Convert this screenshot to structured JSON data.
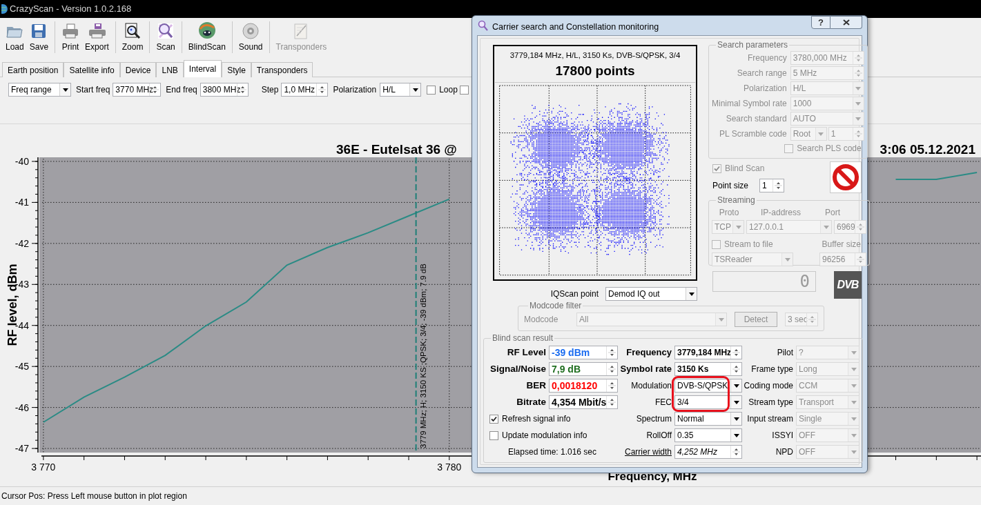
{
  "window": {
    "title": "CrazyScan - Version 1.0.2.168"
  },
  "toolbar": [
    {
      "label": "Load",
      "disabled": false
    },
    {
      "label": "Save",
      "disabled": false
    },
    {
      "label": "Print",
      "disabled": false
    },
    {
      "label": "Export",
      "disabled": false
    },
    {
      "label": "Zoom",
      "disabled": false
    },
    {
      "label": "Scan",
      "disabled": false
    },
    {
      "label": "BlindScan",
      "disabled": false
    },
    {
      "label": "Sound",
      "disabled": false
    },
    {
      "label": "Transponders",
      "disabled": true
    }
  ],
  "tabs": [
    {
      "label": "Earth position",
      "selected": false
    },
    {
      "label": "Satellite info",
      "selected": false
    },
    {
      "label": "Device",
      "selected": false
    },
    {
      "label": "LNB",
      "selected": false
    },
    {
      "label": "Interval",
      "selected": true
    },
    {
      "label": "Style",
      "selected": false
    },
    {
      "label": "Transponders",
      "selected": false
    }
  ],
  "interval": {
    "mode": "Freq range",
    "fields": [
      {
        "label": "Start freq",
        "value": "3770 MHz"
      },
      {
        "label": "End freq",
        "value": "3800 MHz"
      },
      {
        "label": "Step",
        "value": "1,0 MHz"
      }
    ],
    "polarization": {
      "label": "Polarization",
      "value": "H/L"
    },
    "checkboxes": [
      {
        "label": "Loop",
        "checked": false
      },
      {
        "checked": false
      }
    ]
  },
  "plot": {
    "title_parts": [
      "36E - Eutelsat 36 @",
      "3:06 05.12.2021"
    ],
    "chart_data": {
      "type": "line",
      "xlabel": "Frequency, MHz",
      "ylabel": "RF level, dBm",
      "x": [
        3770,
        3771,
        3772,
        3773,
        3774,
        3775,
        3776,
        3777,
        3778,
        3779,
        3780,
        3785,
        3791,
        3792,
        3793
      ],
      "series": [
        {
          "color": "#2a8b85",
          "values": [
            -46.36,
            -45.75,
            -45.26,
            -44.73,
            -44.01,
            -43.43,
            -42.53,
            -42.1,
            -41.74,
            -41.33,
            -40.92,
            null,
            -40.44,
            -40.44,
            -40.27
          ]
        }
      ],
      "grid": true,
      "xlim": [
        3769.9,
        3793.1
      ],
      "ylim": [
        -47.1,
        -39.9
      ],
      "xticks": [
        {
          "value": 3770,
          "label": "3 770"
        },
        {
          "value": 3780,
          "label": "3 780"
        }
      ],
      "yticks": [
        -40,
        -41,
        -42,
        -43,
        -44,
        -45,
        -46,
        -47
      ],
      "ref_lines": [
        {
          "axis": "x",
          "value": 3779.18,
          "color": "#1f7f78"
        }
      ],
      "annotations": [
        "3779 MHz; H; 3150 KS ;QPSK; 3/4; -39 dBm; 7.9 dB"
      ]
    }
  },
  "status_bar": "Cursor Pos: Press Left mouse button in plot region",
  "dialog": {
    "title": "Carrier search and Constellation monitoring",
    "help": "?",
    "constellation": {
      "info": "3779,184 MHz, H/L, 3150 Ks, DVB-S/QPSK, 3/4",
      "points": "17800 points"
    },
    "iq_scan": {
      "label": "IQScan point",
      "value": "Demod IQ out"
    },
    "search_parameters": {
      "title": "Search parameters",
      "disabled": true,
      "rows": [
        {
          "label": "Frequency",
          "value": "3780,000 MHz",
          "kind": "spin"
        },
        {
          "label": "Search range",
          "value": "5 MHz",
          "kind": "spin"
        },
        {
          "label": "Polarization",
          "value": "H/L",
          "kind": "combo"
        },
        {
          "label": "Minimal Symbol rate",
          "value": "1000",
          "kind": "combo"
        },
        {
          "label": "Search standard",
          "value": "AUTO",
          "kind": "combo"
        },
        {
          "label": "PL Scramble code",
          "value": "Root",
          "value2": "1",
          "kind": "combo-spin"
        }
      ],
      "search_pls": {
        "label": "Search PLS code",
        "checked": false
      }
    },
    "blind_scan": {
      "label": "Blind Scan",
      "checked": true,
      "disabled": true
    },
    "point_size": {
      "label": "Point size",
      "value": "1"
    },
    "streaming": {
      "title": "Streaming",
      "disabled": true,
      "proto": {
        "label": "Proto",
        "value": "TCP"
      },
      "ip": {
        "label": "IP-address",
        "value": "127.0.0.1"
      },
      "port": {
        "label": "Port",
        "value": "6969"
      },
      "stream_to_file": {
        "label": "Stream to file",
        "checked": false
      },
      "buffer": {
        "label": "Buffer size",
        "value": "96256"
      },
      "reader": {
        "value": "TSReader"
      }
    },
    "counter": "0",
    "dvb_logo": "DVB",
    "modcode_filter": {
      "title": "Modcode filter",
      "disabled": true,
      "label": "Modcode",
      "value": "All",
      "button": "Detect",
      "interval": "3 sec"
    },
    "result": {
      "title": "Blind scan result",
      "signal": [
        {
          "label": "RF Level",
          "value": "-39 dBm",
          "color": "#1a6cf0"
        },
        {
          "label": "Signal/Noise",
          "value": "7,9 dB",
          "color": "#1f6e1f"
        },
        {
          "label": "BER",
          "value": "0,0018120",
          "color": "#ff0000"
        },
        {
          "label": "Bitrate",
          "value": "4,354 Mbit/s",
          "color": "#000000"
        }
      ],
      "options": [
        {
          "label": "Refresh signal info",
          "checked": true
        },
        {
          "label": "Update modulation info",
          "checked": false
        }
      ],
      "elapsed": "Elapsed time: 1.016 sec",
      "modulation": [
        {
          "label": "Frequency",
          "value": "3779,184 MHz",
          "kind": "key-spin",
          "ringed": false
        },
        {
          "label": "Symbol rate",
          "value": "3150 Ks",
          "kind": "key-spin",
          "ringed": false
        },
        {
          "label": "Modulation",
          "value": "DVB-S/QPSK",
          "kind": "combo",
          "ringed": true
        },
        {
          "label": "FEC",
          "value": "3/4",
          "kind": "combo",
          "ringed": true
        },
        {
          "label": "Spectrum",
          "value": "Normal",
          "kind": "combo",
          "ringed": false
        },
        {
          "label": "RollOff",
          "value": "0.35",
          "kind": "combo",
          "ringed": false
        },
        {
          "label": "Carrier width",
          "value": "4,252 MHz",
          "kind": "link-spin",
          "ringed": false
        }
      ],
      "stream": [
        {
          "label": "Pilot",
          "value": "?",
          "disabled": true
        },
        {
          "label": "Frame type",
          "value": "Long",
          "disabled": true
        },
        {
          "label": "Coding mode",
          "value": "CCM",
          "disabled": true
        },
        {
          "label": "Stream type",
          "value": "Transport",
          "disabled": true
        },
        {
          "label": "Input stream",
          "value": "Single",
          "disabled": true
        },
        {
          "label": "ISSYI",
          "value": "OFF",
          "disabled": true
        },
        {
          "label": "NPD",
          "value": "OFF",
          "disabled": true
        }
      ]
    }
  }
}
